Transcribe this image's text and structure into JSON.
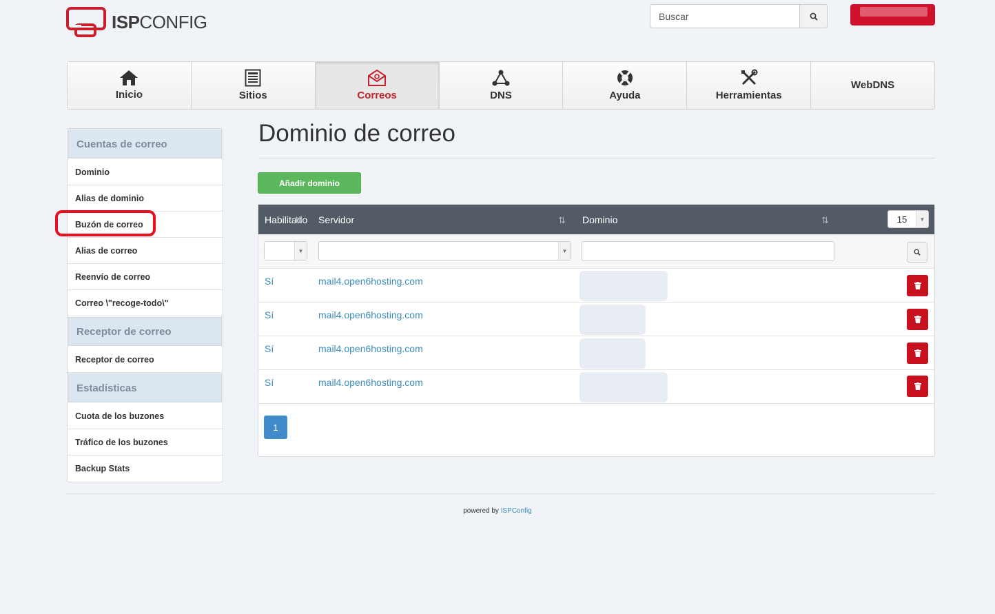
{
  "app": {
    "logo_bold": "ISP",
    "logo_light": "CONFIG"
  },
  "search": {
    "placeholder": "Buscar"
  },
  "nav": {
    "items": [
      {
        "label": "Inicio",
        "icon": "home-icon"
      },
      {
        "label": "Sitios",
        "icon": "list-icon"
      },
      {
        "label": "Correos",
        "icon": "envelope-at-icon",
        "active": true
      },
      {
        "label": "DNS",
        "icon": "network-icon"
      },
      {
        "label": "Ayuda",
        "icon": "lifebuoy-icon"
      },
      {
        "label": "Herramientas",
        "icon": "tools-icon"
      },
      {
        "label": "WebDNS",
        "icon": ""
      }
    ]
  },
  "sidebar": {
    "sections": [
      {
        "title": "Cuentas de correo",
        "items": [
          "Dominio",
          "Alias de dominio",
          "Buzón de correo",
          "Alias de correo",
          "Reenvío de correo",
          "Correo \\\"recoge-todo\\\""
        ]
      },
      {
        "title": "Receptor de correo",
        "items": [
          "Receptor de correo"
        ]
      },
      {
        "title": "Estadísticas",
        "items": [
          "Cuota de los buzones",
          "Tráfico de los buzones",
          "Backup Stats"
        ]
      }
    ]
  },
  "main": {
    "title": "Dominio de correo",
    "add_button": "Añadir dominio",
    "columns": [
      "Habilitado",
      "Servidor",
      "Dominio"
    ],
    "per_page": "15",
    "rows": [
      {
        "enabled": "Sí",
        "server": "mail4.open6hosting.com"
      },
      {
        "enabled": "Sí",
        "server": "mail4.open6hosting.com"
      },
      {
        "enabled": "Sí",
        "server": "mail4.open6hosting.com"
      },
      {
        "enabled": "Sí",
        "server": "mail4.open6hosting.com"
      }
    ],
    "page": "1"
  },
  "footer": {
    "prefix": "powered by",
    "link": "ISPConfig"
  },
  "colors": {
    "brand_red": "#c81f2d",
    "primary_green": "#5cb85c",
    "link_blue": "#3c8dbc",
    "header_dark": "#535c66"
  }
}
